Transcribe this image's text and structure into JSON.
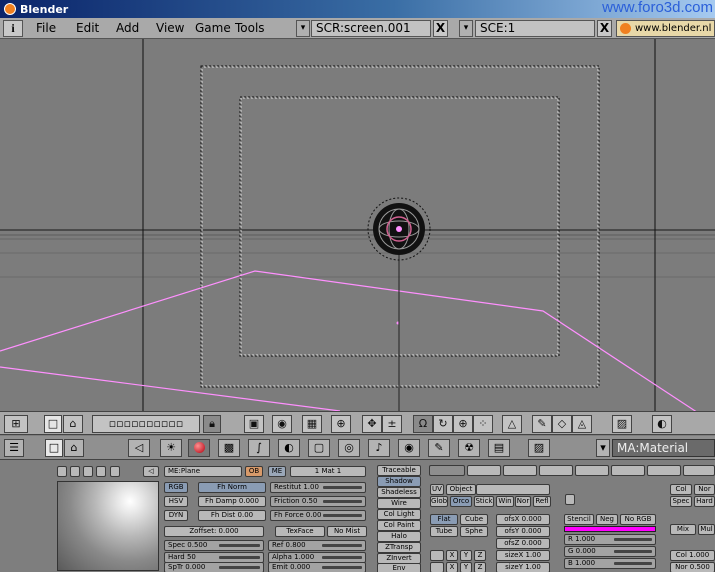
{
  "app": {
    "title": "Blender",
    "watermark": "www.foro3d.com"
  },
  "menubar": {
    "info_glyph": "i",
    "menus": [
      "File",
      "Edit",
      "Add",
      "View",
      "Game",
      "Tools"
    ],
    "screen_field": "SCR:screen.001",
    "scene_field": "SCE:1",
    "close_glyph": "X",
    "dropdown_glyph": "▾",
    "weblink": "www.blender.nl"
  },
  "material": {
    "name_field": "MA:Material",
    "me_field": "ME:Plane",
    "ob_label": "OB",
    "me_label": "ME",
    "mat_count": "1 Mat 1",
    "buttons_left_col": [
      "RGB",
      "HSV",
      "DYN"
    ],
    "fh_norm": "Fh Norm",
    "fh_damp": "Fh Damp 0.000",
    "fh_dist": "Fh Dist 0.00",
    "restitut": "Restitut 1.00",
    "friction": "Friction 0.50",
    "fh_force": "Fh Force 0.00",
    "zoffset": "Zoffset: 0.000",
    "texface": "TexFace",
    "no_mist": "No Mist",
    "spec": "Spec 0.500",
    "hard": "Hard 50",
    "sptr": "SpTr 0.000",
    "ref": "Ref  0.800",
    "alpha": "Alpha 1.000",
    "emit": "Emit 0.000",
    "mode_toggles": [
      "Traceable",
      "Shadow",
      "Shadeless",
      "Wire",
      "Col Light",
      "Col Paint",
      "Halo",
      "ZTransp",
      "ZInvert",
      "Env"
    ],
    "map_input": [
      "UV",
      "Object"
    ],
    "map_input2": [
      "Glob",
      "Orco",
      "Stick",
      "Win",
      "Nor",
      "Refl"
    ],
    "flat": "Flat",
    "cube": "Cube",
    "tube": "Tube",
    "sphe": "Sphe",
    "ofs_x": "ofsX 0.000",
    "ofs_y": "ofsY 0.000",
    "ofs_z": "ofsZ 0.000",
    "size_x": "sizeX 1.00",
    "size_y": "sizeY 1.00",
    "xyz": [
      "X",
      "Y",
      "Z"
    ],
    "stencil": "Stencil",
    "neg": "Neg",
    "no_rgb": "No RGB",
    "r": "R 1.000",
    "g": "G 0.000",
    "b": "B 1.000",
    "col": "Col",
    "nor": "Nor",
    "spec_short": "Spec",
    "hard_short": "Hard",
    "mix": "Mix",
    "mul": "Mul",
    "col_val": "Col 1.000",
    "nor_val": "Nor 0.500",
    "tex_color": "#ff00ff"
  },
  "viewport": {
    "background": "#7c7c7c",
    "selection_color": "#ff80ff"
  },
  "icons": [
    "info-icon",
    "blender-logo-icon",
    "dropdown-icon",
    "close-icon",
    "home-icon",
    "lock-icon",
    "sphere-material-icon",
    "radiation-icon",
    "lamp-icon"
  ]
}
